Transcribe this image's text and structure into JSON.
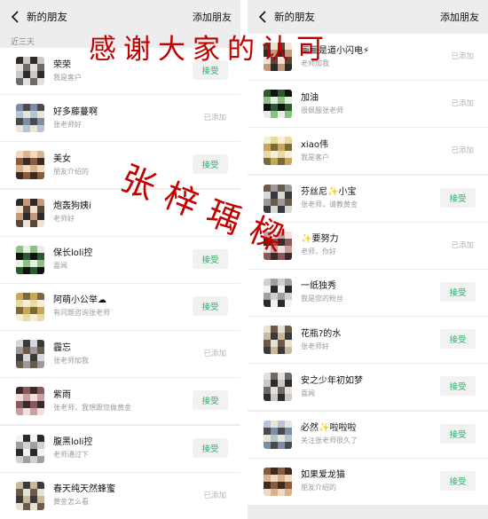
{
  "left": {
    "header": {
      "title": "新的朋友",
      "action": "添加朋友"
    },
    "section_label": "近三天",
    "rows": [
      {
        "name": "荣荣",
        "sub": "我是客户",
        "status": "接受",
        "accept": true
      },
      {
        "name": "好多藤蔓啊",
        "sub": "张老师好",
        "status": "已添加",
        "accept": false
      },
      {
        "name": "美女",
        "sub": "朋友介绍的",
        "status": "接受",
        "accept": true
      },
      {
        "name": "炮轰狗姨i",
        "sub": "老师好",
        "status": "",
        "accept": false
      },
      {
        "name": "保长loli控",
        "sub": "喜闻",
        "status": "接受",
        "accept": true
      },
      {
        "name": "阿萌小公举☁",
        "sub": "有问题咨询张老师",
        "status": "接受",
        "accept": true
      },
      {
        "name": "霾忘",
        "sub": "张老师加我",
        "status": "已添加",
        "accept": false
      },
      {
        "name": "紫雨",
        "sub": "张老师，我想跟您做黄金",
        "status": "接受",
        "accept": true
      },
      {
        "name": "腹黑loli控",
        "sub": "老师通过下",
        "status": "接受",
        "accept": true
      },
      {
        "name": "春天纯天然蜂蜜",
        "sub": "黄金怎么看",
        "status": "已添加",
        "accept": false
      }
    ]
  },
  "right": {
    "header": {
      "title": "新的朋友",
      "action": "添加朋友"
    },
    "rows": [
      {
        "name": "画画是道小闪电⚡",
        "sub": "老师加我",
        "status": "已添加",
        "accept": false
      },
      {
        "name": "加油",
        "sub": "很佩服张老师",
        "status": "已添加",
        "accept": false
      },
      {
        "name": "xiao伟",
        "sub": "我是客户",
        "status": "已添加",
        "accept": false
      },
      {
        "name": "芬丝尼✨小宝",
        "sub": "张老师，请教黄金",
        "status": "接受",
        "accept": true
      },
      {
        "name": "✨要努力",
        "sub": "老师，你好",
        "status": "已添加",
        "accept": false
      },
      {
        "name": "一纸独秀",
        "sub": "我是您的粉丝",
        "status": "接受",
        "accept": true
      },
      {
        "name": "花瓶?的水",
        "sub": "张老师好",
        "status": "接受",
        "accept": true
      },
      {
        "name": "安之少年初如梦",
        "sub": "喜闻",
        "status": "接受",
        "accept": true
      },
      {
        "name": "必然✨啦啦啦",
        "sub": "关注张老师很久了",
        "status": "接受",
        "accept": true
      },
      {
        "name": "如果爱龙猫",
        "sub": "朋友介绍的",
        "status": "接受",
        "accept": true
      }
    ]
  },
  "watermarks": {
    "top": "感谢大家的认可",
    "middle": "张梓瑀樑"
  },
  "icons": {
    "back": "chevron-left-icon"
  },
  "colors": {
    "accept_text": "#2aae67",
    "watermark": "#c20000",
    "bg": "#ededed"
  }
}
